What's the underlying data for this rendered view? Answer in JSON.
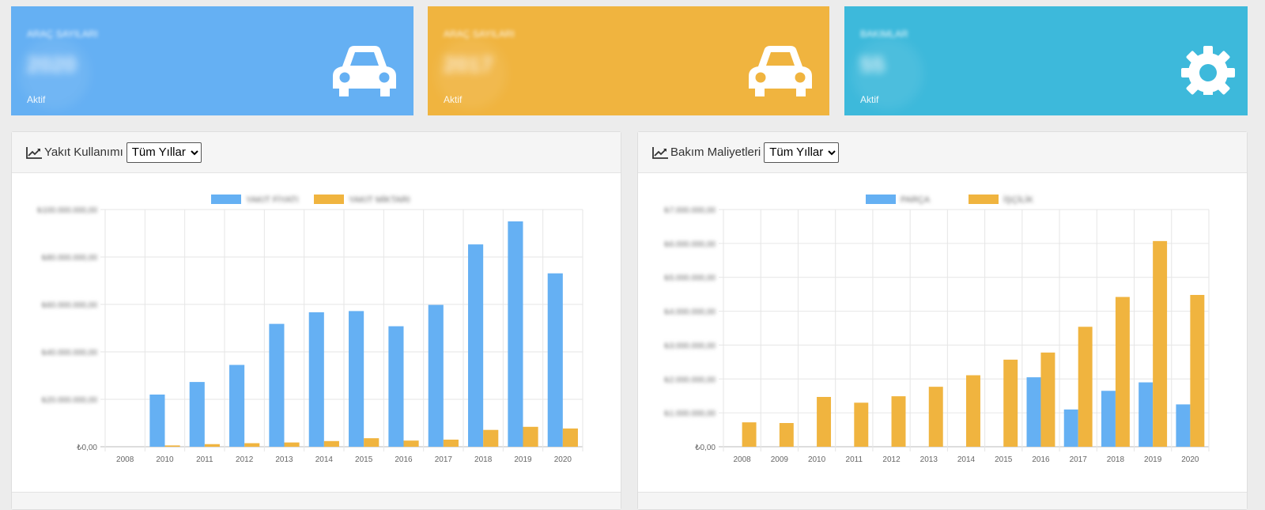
{
  "tiles": [
    {
      "title": "ARAÇ SAYILARI",
      "value": "2020",
      "status": "Aktif",
      "color": "#65b0f3",
      "icon": "car-icon"
    },
    {
      "title": "ARAÇ SAYILARI",
      "value": "2017",
      "status": "Aktif",
      "color": "#f0b43f",
      "icon": "car-icon"
    },
    {
      "title": "BAKIMLAR",
      "value": "55",
      "status": "Aktif",
      "color": "#3db9db",
      "icon": "gear-icon"
    }
  ],
  "panels": [
    {
      "title": "Yakıt Kullanımı",
      "filter": {
        "selected": "Tüm Yıllar",
        "options": [
          "Tüm Yıllar"
        ]
      },
      "icon": "line-chart-icon"
    },
    {
      "title": "Bakım Maliyetleri",
      "filter": {
        "selected": "Tüm Yıllar",
        "options": [
          "Tüm Yıllar"
        ]
      },
      "icon": "line-chart-icon"
    }
  ],
  "chart_data": [
    {
      "type": "bar",
      "categories": [
        "2008",
        "2010",
        "2011",
        "2012",
        "2013",
        "2014",
        "2015",
        "2016",
        "2017",
        "2018",
        "2019",
        "2020"
      ],
      "series": [
        {
          "name": "YAKIT FİYATI",
          "color": "#65b0f3",
          "values": [
            0,
            22000000,
            27300000,
            34500000,
            51800000,
            56700000,
            57200000,
            50800000,
            59800000,
            85300000,
            95000000,
            73100000
          ]
        },
        {
          "name": "YAKIT MİKTARI",
          "color": "#f0b43f",
          "values": [
            0,
            550000,
            1100000,
            1500000,
            1800000,
            2400000,
            3600000,
            2600000,
            3000000,
            7100000,
            8400000,
            7700000
          ]
        }
      ],
      "ylim": [
        0,
        100000000
      ],
      "yticks": [
        "₺0,00",
        "₺20.000.000,00",
        "₺40.000.000,00",
        "₺60.000.000,00",
        "₺80.000.000,00",
        "₺100.000.000,00"
      ],
      "grid": true,
      "legend": "top"
    },
    {
      "type": "bar",
      "categories": [
        "2008",
        "2009",
        "2010",
        "2011",
        "2012",
        "2013",
        "2014",
        "2015",
        "2016",
        "2017",
        "2018",
        "2019",
        "2020"
      ],
      "series": [
        {
          "name": "PARÇA",
          "color": "#65b0f3",
          "values": [
            0,
            0,
            0,
            0,
            0,
            0,
            0,
            0,
            2050000,
            1100000,
            1650000,
            1900000,
            1250000
          ]
        },
        {
          "name": "İŞÇİLİK",
          "color": "#f0b43f",
          "values": [
            720000,
            700000,
            1470000,
            1300000,
            1490000,
            1770000,
            2110000,
            2570000,
            2780000,
            3540000,
            4420000,
            6070000,
            4480000
          ]
        }
      ],
      "ylim": [
        0,
        7000000
      ],
      "yticks": [
        "₺0,00",
        "₺1.000.000,00",
        "₺2.000.000,00",
        "₺3.000.000,00",
        "₺4.000.000,00",
        "₺5.000.000,00",
        "₺6.000.000,00",
        "₺7.000.000,00"
      ],
      "grid": true,
      "legend": "top"
    }
  ]
}
